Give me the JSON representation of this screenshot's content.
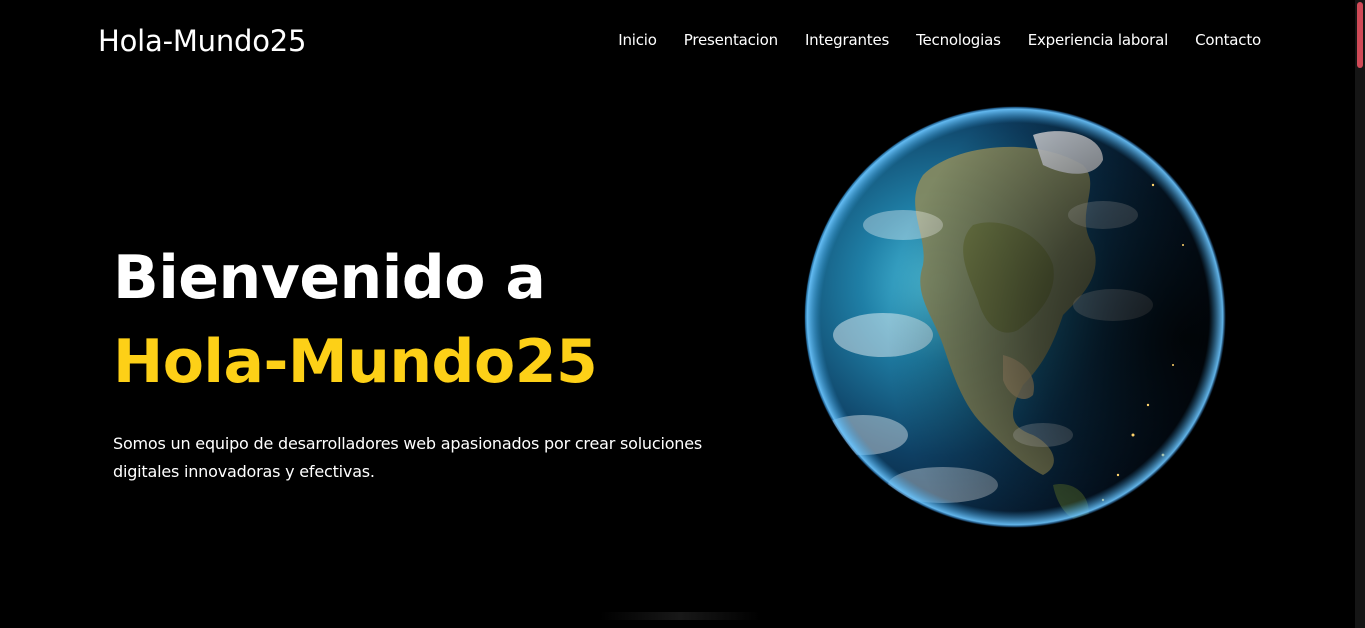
{
  "header": {
    "logo": "Hola-Mundo25",
    "nav": [
      {
        "label": "Inicio"
      },
      {
        "label": "Presentacion"
      },
      {
        "label": "Integrantes"
      },
      {
        "label": "Tecnologias"
      },
      {
        "label": "Experiencia laboral"
      },
      {
        "label": "Contacto"
      }
    ]
  },
  "hero": {
    "title_line1": "Bienvenido a",
    "title_line2": "Hola-Mundo25",
    "description": "Somos un equipo de desarrolladores web apasionados por crear soluciones digitales innovadoras y efectivas."
  },
  "colors": {
    "background": "#000000",
    "accent": "#fdd017",
    "scroll_thumb": "#d04a57"
  },
  "icons": {
    "hero_image": "earth-globe-icon"
  }
}
